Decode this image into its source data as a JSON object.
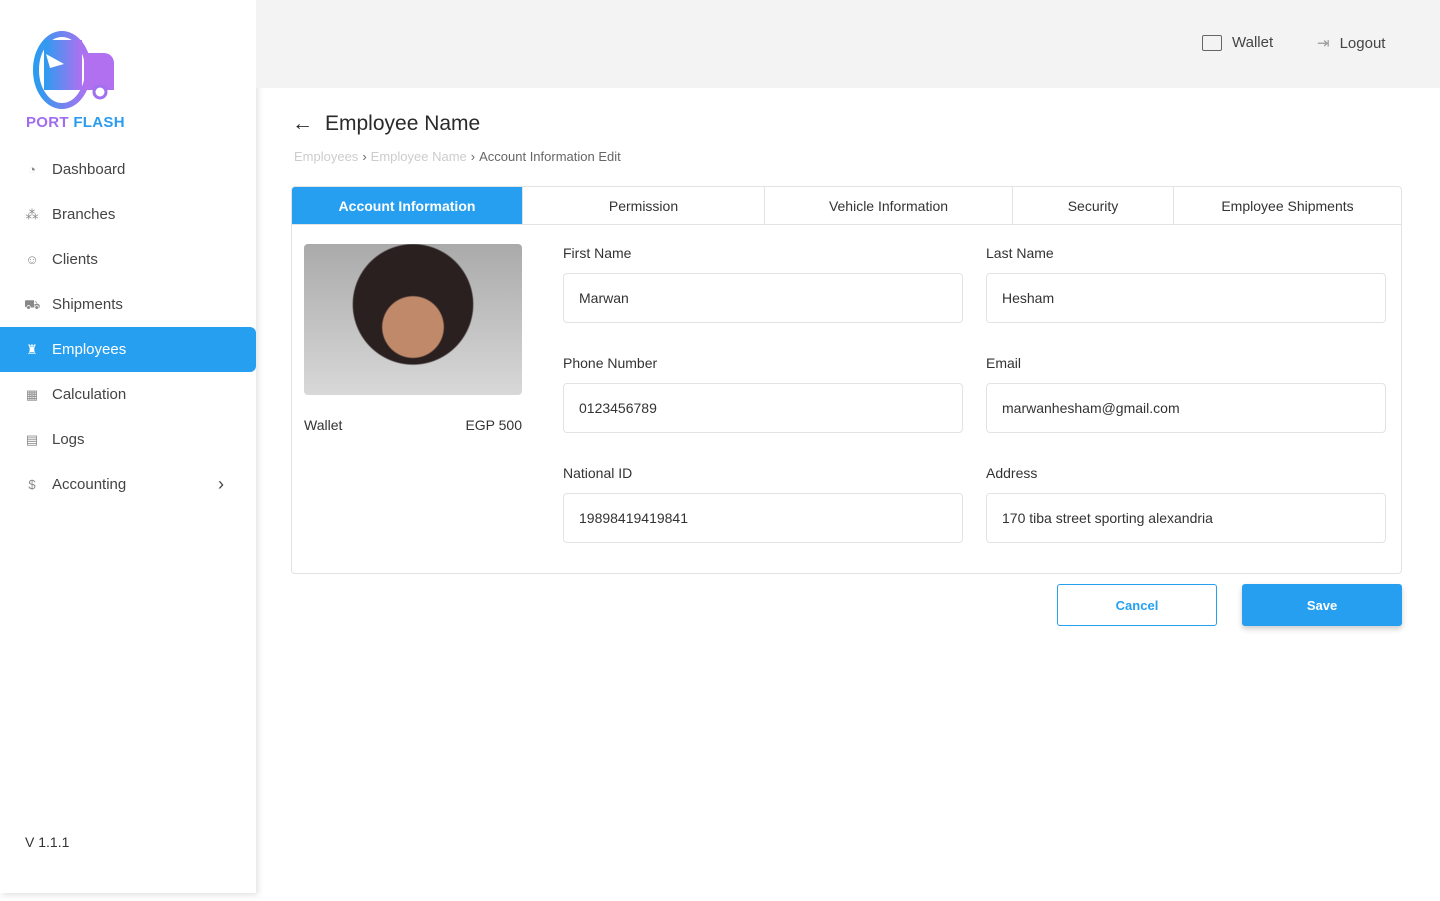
{
  "brand": {
    "name_part1": "PORT",
    "name_part2": "FLASH"
  },
  "sidebar": {
    "items": [
      {
        "label": "Dashboard",
        "icon": "pie-chart-icon"
      },
      {
        "label": "Branches",
        "icon": "branches-icon"
      },
      {
        "label": "Clients",
        "icon": "clients-icon"
      },
      {
        "label": "Shipments",
        "icon": "truck-icon"
      },
      {
        "label": "Employees",
        "icon": "employees-icon"
      },
      {
        "label": "Calculation",
        "icon": "calculator-icon"
      },
      {
        "label": "Logs",
        "icon": "logs-icon"
      },
      {
        "label": "Accounting",
        "icon": "dollar-icon"
      }
    ],
    "version": "V 1.1.1"
  },
  "topbar": {
    "wallet": "Wallet",
    "logout": "Logout"
  },
  "page": {
    "title": "Employee Name",
    "breadcrumb": [
      "Employees",
      "Employee Name",
      "Account Information Edit"
    ]
  },
  "tabs": [
    "Account Information",
    "Permission",
    "Vehicle Information",
    "Security",
    "Employee Shipments"
  ],
  "profile": {
    "wallet_label": "Wallet",
    "wallet_value": "EGP 500"
  },
  "form": {
    "first_name": {
      "label": "First Name",
      "value": "Marwan"
    },
    "last_name": {
      "label": "Last Name",
      "value": "Hesham"
    },
    "phone": {
      "label": "Phone Number",
      "value": "0123456789"
    },
    "email": {
      "label": "Email",
      "value": "marwanhesham@gmail.com"
    },
    "national_id": {
      "label": "National ID",
      "value": "19898419419841"
    },
    "address": {
      "label": "Address",
      "value": "170 tiba street sporting alexandria"
    }
  },
  "actions": {
    "cancel": "Cancel",
    "save": "Save"
  },
  "colors": {
    "accent": "#279ff0"
  }
}
